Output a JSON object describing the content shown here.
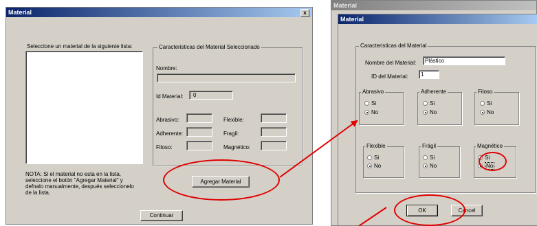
{
  "left_dialog": {
    "title": "Material",
    "close_glyph": "x",
    "select_label": "Seleccione un material de la siguiente lista:",
    "characteristics_title": "Caracteristicas del Material Seleccionado",
    "name_label": "Nombre:",
    "id_label": "Id Material:",
    "id_value": "0",
    "attributes": [
      {
        "label": "Abrasivo:"
      },
      {
        "label": "Flexible:"
      },
      {
        "label": "Adherente:"
      },
      {
        "label": "Fragil:"
      },
      {
        "label": "Filoso:"
      },
      {
        "label": "Magnético:"
      }
    ],
    "note_line1": "NOTA:     Si el material no esta en la lista,",
    "note_line2": "seleccione el botón \"Agregar Material\"  y",
    "note_line3": "defnalo manualmente, después seleccionelo",
    "note_line4": "de la lista.",
    "add_button": "Agregar Material",
    "continue_button": "Continuar"
  },
  "right_dialog": {
    "outer_title": "Material",
    "title": "Material",
    "characteristics_title": "Caracteristicas del Material",
    "name_label": "Nombre del Material:",
    "name_value": "Plástico",
    "id_label": "ID del Material:",
    "id_value": "1",
    "groups": [
      {
        "title": "Abrasivo",
        "yes": "Si",
        "no": "No",
        "selected": "No"
      },
      {
        "title": "Adherente",
        "yes": "Si",
        "no": "No",
        "selected": "No"
      },
      {
        "title": "Filoso",
        "yes": "Si",
        "no": "No",
        "selected": "No"
      },
      {
        "title": "Flexible",
        "yes": "Si",
        "no": "No",
        "selected": "No"
      },
      {
        "title": "Frágil",
        "yes": "Si",
        "no": "No",
        "selected": "No"
      },
      {
        "title": "Magnético",
        "yes": "Si",
        "no": "No",
        "selected": "No"
      }
    ],
    "ok_button": "OK",
    "cancel_button": "Cancel"
  },
  "annotation_color": "#e00000"
}
